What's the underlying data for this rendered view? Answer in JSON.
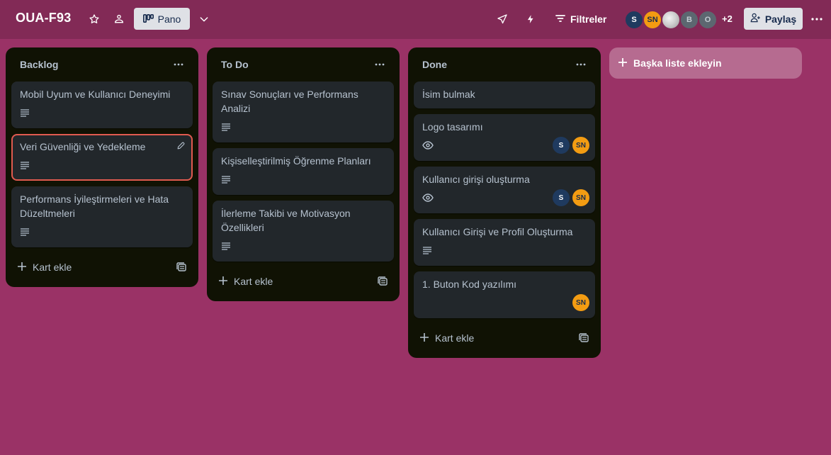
{
  "header": {
    "board_title": "OUA-F93",
    "view_label": "Pano",
    "filter_label": "Filtreler",
    "extra_members": "+2",
    "share_label": "Paylaş",
    "members": [
      {
        "initials": "S"
      },
      {
        "initials": "SN"
      },
      {
        "initials": ""
      },
      {
        "initials": "B"
      },
      {
        "initials": "O"
      }
    ]
  },
  "lists": [
    {
      "title": "Backlog",
      "add_card": "Kart ekle",
      "cards": [
        {
          "title": "Mobil Uyum ve Kullanıcı Deneyimi"
        },
        {
          "title": "Veri Güvenliği ve Yedekleme"
        },
        {
          "title": "Performans İyileştirmeleri ve Hata Düzeltmeleri"
        }
      ]
    },
    {
      "title": "To Do",
      "add_card": "Kart ekle",
      "cards": [
        {
          "title": "Sınav Sonuçları ve Performans Analizi"
        },
        {
          "title": "Kişiselleştirilmiş Öğrenme Planları"
        },
        {
          "title": "İlerleme Takibi ve Motivasyon Özellikleri"
        }
      ]
    },
    {
      "title": "Done",
      "add_card": "Kart ekle",
      "cards": [
        {
          "title": "İsim bulmak"
        },
        {
          "title": "Logo tasarımı",
          "members": [
            "S",
            "SN"
          ]
        },
        {
          "title": "Kullanıcı girişi oluşturma",
          "members": [
            "S",
            "SN"
          ]
        },
        {
          "title": "Kullanıcı Girişi ve Profil Oluşturma"
        },
        {
          "title": "1. Buton Kod yazılımı",
          "members": [
            "SN"
          ]
        }
      ]
    }
  ],
  "add_list_label": "Başka liste ekleyin",
  "colors": {
    "board_bg": "#9a3266",
    "header_bg": "#822a56",
    "list_bg": "#101204",
    "card_bg": "#22272b",
    "focus_ring": "#e05a4f",
    "avatar_sn": "#f39c12",
    "avatar_s": "#1f3a5f"
  },
  "icons": [
    "star-icon",
    "workspace-visibility-icon",
    "board-view-icon",
    "chevron-down-icon",
    "send-icon",
    "automation-bolt-icon",
    "filter-icon",
    "add-person-icon",
    "more-horizontal-icon",
    "description-icon",
    "watch-eye-icon",
    "edit-pencil-icon",
    "plus-icon",
    "card-template-icon"
  ]
}
